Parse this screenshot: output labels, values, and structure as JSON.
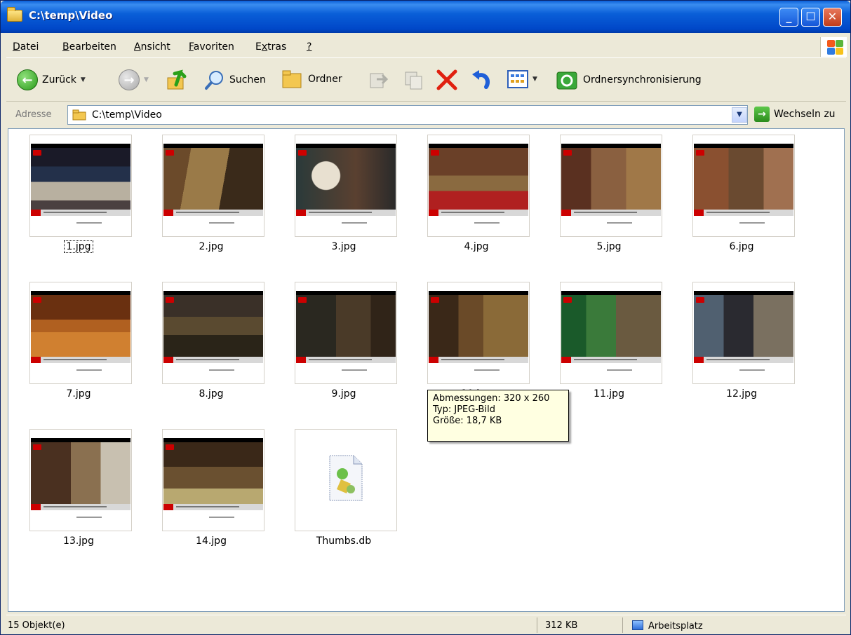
{
  "window": {
    "title": "C:\\temp\\Video"
  },
  "menu": [
    {
      "underline": "D",
      "rest": "atei"
    },
    {
      "underline": "B",
      "rest": "earbeiten"
    },
    {
      "underline": "A",
      "rest": "nsicht"
    },
    {
      "underline": "F",
      "rest": "avoriten"
    },
    {
      "pre": "E",
      "underline": "x",
      "rest": "tras"
    },
    {
      "underline": "?",
      "rest": ""
    }
  ],
  "toolbar": {
    "back_label": "Zurück",
    "search_label": "Suchen",
    "folders_label": "Ordner",
    "sync_label": "Ordnersynchronisierung"
  },
  "address": {
    "label": "Adresse",
    "path": "C:\\temp\\Video",
    "go_label": "Wechseln zu"
  },
  "files": [
    {
      "name": "1.jpg",
      "selected": true
    },
    {
      "name": "2.jpg"
    },
    {
      "name": "3.jpg"
    },
    {
      "name": "4.jpg"
    },
    {
      "name": "5.jpg"
    },
    {
      "name": "6.jpg"
    },
    {
      "name": "7.jpg"
    },
    {
      "name": "8.jpg"
    },
    {
      "name": "9.jpg"
    },
    {
      "name": "10.jpg"
    },
    {
      "name": "11.jpg"
    },
    {
      "name": "12.jpg"
    },
    {
      "name": "13.jpg"
    },
    {
      "name": "14.jpg"
    },
    {
      "name": "Thumbs.db"
    }
  ],
  "tooltip": {
    "line1": "Abmessungen: 320 x 260",
    "line2": "Typ: JPEG-Bild",
    "line3": "Größe: 18,7 KB"
  },
  "status": {
    "count": "15 Objekt(e)",
    "size": "312 KB",
    "zone": "Arbeitsplatz"
  },
  "colors": {
    "titlebar": "#0a5fd8",
    "close_button": "#c13d1a",
    "tooltip_bg": "#ffffe1",
    "chrome": "#ece9d8"
  }
}
